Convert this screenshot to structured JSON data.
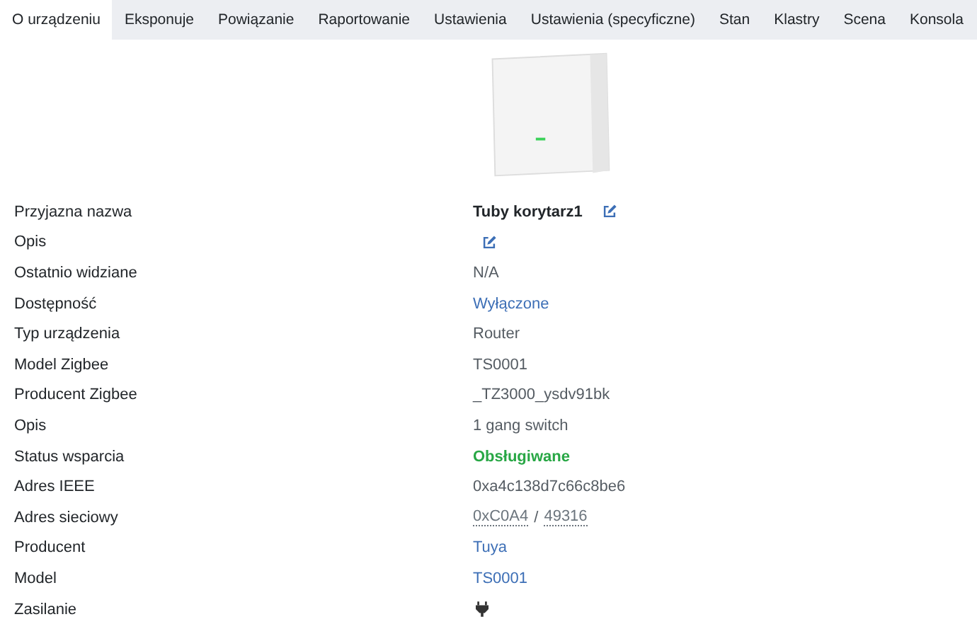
{
  "tabs": [
    {
      "label": "O urządzeniu",
      "selected": true
    },
    {
      "label": "Eksponuje",
      "selected": false
    },
    {
      "label": "Powiązanie",
      "selected": false
    },
    {
      "label": "Raportowanie",
      "selected": false
    },
    {
      "label": "Ustawienia",
      "selected": false
    },
    {
      "label": "Ustawienia (specyficzne)",
      "selected": false
    },
    {
      "label": "Stan",
      "selected": false
    },
    {
      "label": "Klastry",
      "selected": false
    },
    {
      "label": "Scena",
      "selected": false
    },
    {
      "label": "Konsola",
      "selected": false
    }
  ],
  "rows": [
    {
      "label": "Przyjazna nazwa",
      "kind": "name",
      "value": "Tuby korytarz1"
    },
    {
      "label": "Opis",
      "kind": "edit"
    },
    {
      "label": "Ostatnio widziane",
      "kind": "plain",
      "value": "N/A"
    },
    {
      "label": "Dostępność",
      "kind": "link",
      "value": "Wyłączone"
    },
    {
      "label": "Typ urządzenia",
      "kind": "plain",
      "value": "Router"
    },
    {
      "label": "Model Zigbee",
      "kind": "plain",
      "value": "TS0001"
    },
    {
      "label": "Producent Zigbee",
      "kind": "plain",
      "value": "_TZ3000_ysdv91bk"
    },
    {
      "label": "Opis",
      "kind": "plain",
      "value": "1 gang switch"
    },
    {
      "label": "Status wsparcia",
      "kind": "success",
      "value": "Obsługiwane"
    },
    {
      "label": "Adres IEEE",
      "kind": "plain",
      "value": "0xa4c138d7c66c8be6"
    },
    {
      "label": "Adres sieciowy",
      "kind": "address",
      "parts": [
        "0xC0A4",
        "49316"
      ],
      "separator": "/"
    },
    {
      "label": "Producent",
      "kind": "link",
      "value": "Tuya"
    },
    {
      "label": "Model",
      "kind": "link",
      "value": "TS0001"
    },
    {
      "label": "Zasilanie",
      "kind": "power"
    }
  ]
}
